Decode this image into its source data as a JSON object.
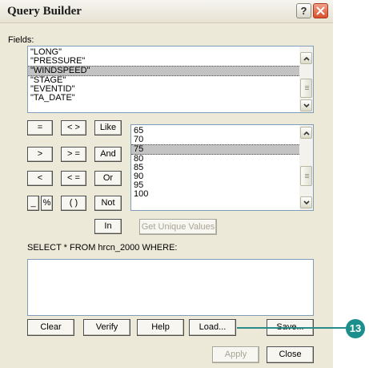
{
  "window": {
    "title": "Query Builder",
    "help_glyph": "?"
  },
  "fields": {
    "label": "Fields:",
    "items": [
      "\"LONG\"",
      "\"PRESSURE\"",
      "\"WINDSPEED\"",
      "\"STAGE\"",
      "\"EVENTID\"",
      "\"TA_DATE\""
    ],
    "selected": "\"WINDSPEED\""
  },
  "operators": {
    "equals": "=",
    "not_equal": "< >",
    "like": "Like",
    "greater": ">",
    "greater_equal": "> =",
    "and": "And",
    "less": "<",
    "less_equal": "< =",
    "or": "Or",
    "underscore": "_",
    "percent": "%",
    "parens": "( )",
    "not": "Not",
    "in": "In"
  },
  "values": {
    "items": [
      "65",
      "70",
      "75",
      "80",
      "85",
      "90",
      "95",
      "100"
    ],
    "selected": "75"
  },
  "get_unique_values_label": "Get Unique Values",
  "query": {
    "label": "SELECT * FROM hrcn_2000 WHERE:",
    "text": ""
  },
  "buttons": {
    "clear": "Clear",
    "verify": "Verify",
    "help": "Help",
    "load": "Load...",
    "save": "Save...",
    "apply": "Apply",
    "close": "Close"
  },
  "callout": {
    "number": "13"
  },
  "colors": {
    "callout": "#1b8f8c",
    "selection": "#c3c3c3",
    "dialog_bg": "#ece9d8"
  }
}
